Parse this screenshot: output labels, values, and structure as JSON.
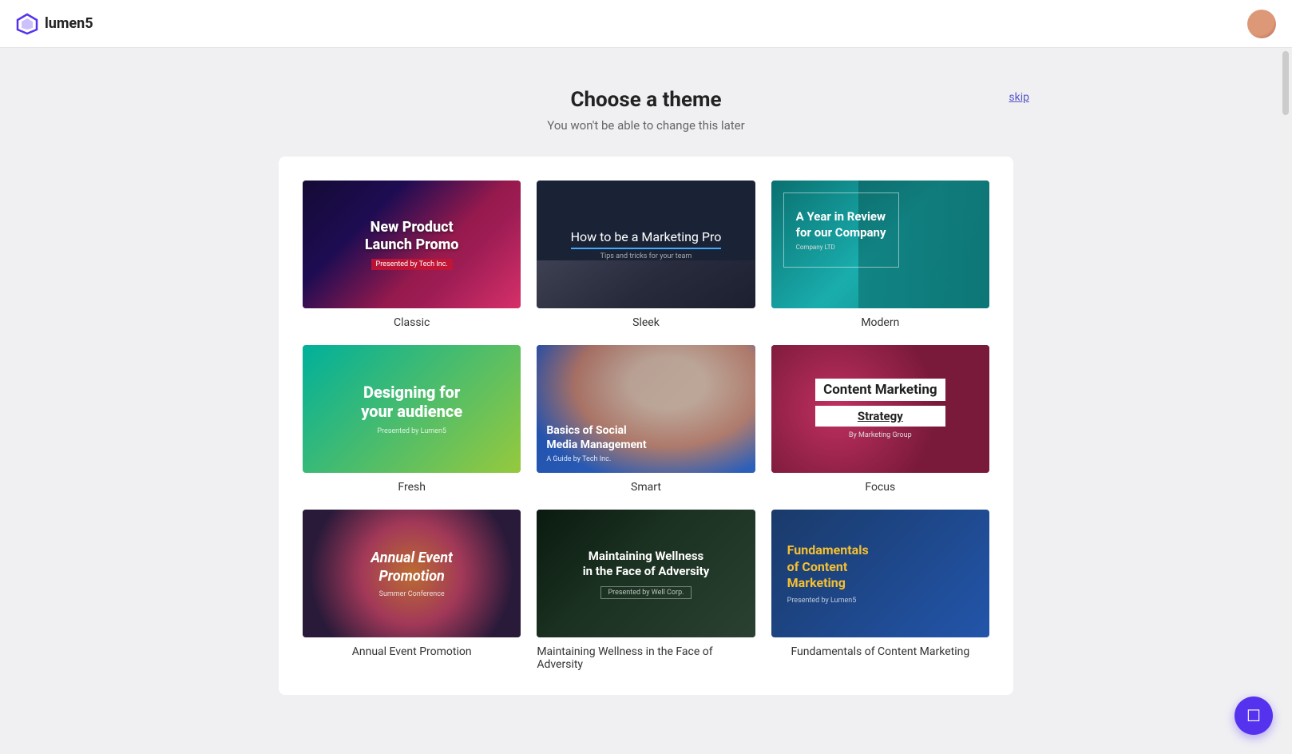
{
  "header": {
    "logo_text": "lumen5",
    "logo_icon": "◇"
  },
  "page": {
    "title": "Choose a theme",
    "subtitle": "You won't be able to change this later",
    "skip_label": "skip"
  },
  "themes": [
    {
      "id": "classic",
      "label": "Classic",
      "card_title": "New Product Launch Promo",
      "card_subtitle": "Presented by Tech Inc.",
      "style": "classic"
    },
    {
      "id": "sleek",
      "label": "Sleek",
      "card_title": "How to be a Marketing Pro",
      "card_subtitle": "Tips and tricks for your team",
      "style": "sleek"
    },
    {
      "id": "modern",
      "label": "Modern",
      "card_title": "A Year in Review for our Company",
      "card_subtitle": "Company LTD",
      "style": "modern"
    },
    {
      "id": "fresh",
      "label": "Fresh",
      "card_title": "Designing for your audience",
      "card_subtitle": "Presented by Lumen5",
      "style": "fresh"
    },
    {
      "id": "smart",
      "label": "Smart",
      "card_title": "Basics of Social Media Management",
      "card_subtitle": "A Guide by Tech Inc.",
      "style": "smart"
    },
    {
      "id": "focus",
      "label": "Focus",
      "card_title": "Content Marketing",
      "card_title2": "Strategy",
      "card_subtitle": "By Marketing Group",
      "style": "focus"
    },
    {
      "id": "annual",
      "label": "Annual Event Promotion",
      "card_title": "Annual Event Promotion",
      "card_subtitle": "Summer Conference",
      "style": "annual"
    },
    {
      "id": "wellness",
      "label": "Maintaining Wellness in the Face of Adversity",
      "card_title": "Maintaining Wellness in the Face of Adversity",
      "card_subtitle": "Presented by Well Corp.",
      "style": "wellness"
    },
    {
      "id": "fundamentals",
      "label": "Fundamentals of Content Marketing",
      "card_title": "Fundamentals of Content Marketing",
      "card_subtitle": "Presented by Lumen5",
      "style": "fundamentals"
    }
  ],
  "chat": {
    "icon": "💬"
  }
}
